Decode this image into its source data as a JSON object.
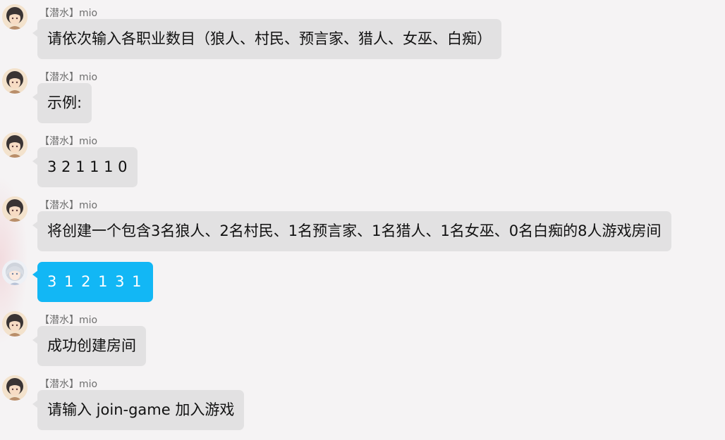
{
  "messages": [
    {
      "sender": "【潜水】mio",
      "text": "请依次输入各职业数目（狼人、村民、预言家、猎人、女巫、白痴）"
    },
    {
      "sender": "【潜水】mio",
      "text": "示例:"
    },
    {
      "sender": "【潜水】mio",
      "text": "3 2 1 1 1 0"
    },
    {
      "sender": "【潜水】mio",
      "text": "将创建一个包含3名狼人、2名村民、1名预言家、1名猎人、1名女巫、0名白痴的8人游戏房间"
    },
    {
      "sender": "",
      "text": "3 1 2 1 3 1"
    },
    {
      "sender": "【潜水】mio",
      "text": "成功创建房间"
    },
    {
      "sender": "【潜水】mio",
      "text": "请输入 join-game 加入游戏"
    }
  ],
  "colors": {
    "self_bubble": "#12b7f5",
    "other_bubble": "#e2e1e2",
    "background": "#f5f3f4"
  },
  "icons": {
    "bot_avatar": "anime-girl-dark-hair-avatar",
    "user_avatar": "anime-girl-silver-hair-avatar"
  }
}
